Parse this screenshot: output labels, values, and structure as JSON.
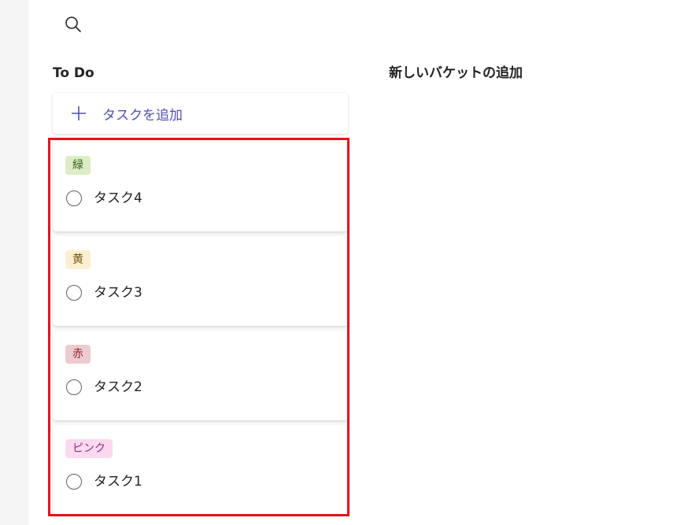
{
  "search": {
    "icon": "search-icon"
  },
  "board": {
    "bucket": {
      "title": "To Do",
      "add_task_label": "タスクを追加",
      "tasks": [
        {
          "label": "緑",
          "label_bg": "#dcedc5",
          "label_fg": "#3b5e21",
          "title": "タスク4"
        },
        {
          "label": "黄",
          "label_bg": "#fcefd0",
          "label_fg": "#6d5413",
          "title": "タスク3"
        },
        {
          "label": "赤",
          "label_bg": "#eccbcf",
          "label_fg": "#8c2430",
          "title": "タスク2"
        },
        {
          "label": "ピンク",
          "label_bg": "#fbd9ef",
          "label_fg": "#9b2b7a",
          "title": "タスク1"
        }
      ]
    },
    "new_bucket_label": "新しいバケットの追加"
  },
  "colors": {
    "accent": "#4f52b2",
    "highlight": "#e0141e"
  }
}
